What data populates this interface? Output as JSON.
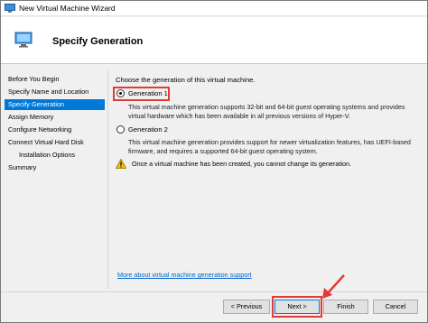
{
  "window": {
    "title": "New Virtual Machine Wizard"
  },
  "header": {
    "title": "Specify Generation"
  },
  "sidebar": {
    "items": [
      {
        "label": "Before You Begin"
      },
      {
        "label": "Specify Name and Location"
      },
      {
        "label": "Specify Generation"
      },
      {
        "label": "Assign Memory"
      },
      {
        "label": "Configure Networking"
      },
      {
        "label": "Connect Virtual Hard Disk"
      },
      {
        "label": "Installation Options"
      },
      {
        "label": "Summary"
      }
    ]
  },
  "main": {
    "intro": "Choose the generation of this virtual machine.",
    "options": [
      {
        "label": "Generation 1",
        "selected": true,
        "description": [
          "This virtual machine generation supports 32-bit and 64-bit guest operating systems and provides",
          "virtual hardware which has been available in all previous versions of Hyper-V."
        ]
      },
      {
        "label": "Generation 2",
        "selected": false,
        "description": [
          "This virtual machine generation provides support for newer virtualization features, has UEFI-based",
          "firmware, and requires a supported 64-bit guest operating system."
        ]
      }
    ],
    "warning": "Once a virtual machine has been created, you cannot change its generation.",
    "more_link": "More about virtual machine generation support"
  },
  "buttons": {
    "previous": "< Previous",
    "next": "Next >",
    "finish": "Finish",
    "cancel": "Cancel"
  },
  "colors": {
    "accent": "#0078d7",
    "highlight": "#e13a37",
    "link": "#0066cc"
  }
}
